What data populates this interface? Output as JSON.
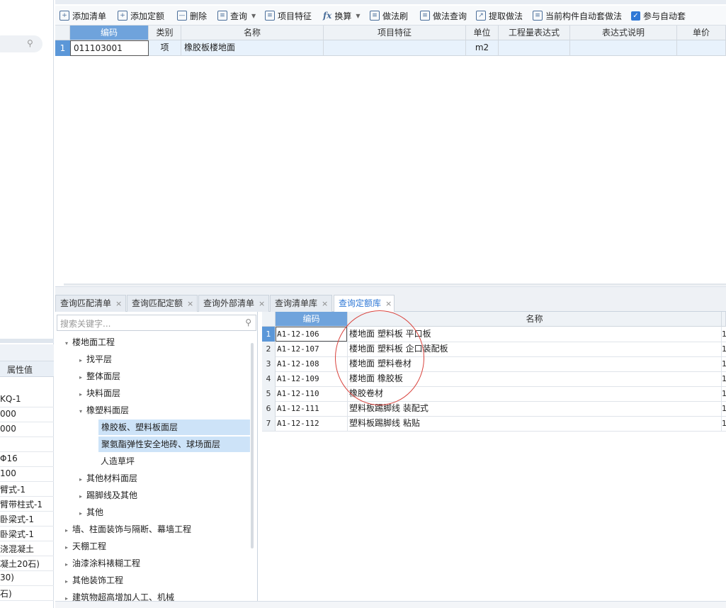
{
  "left_panel": {
    "prop_header": "属性值",
    "prop_values": [
      "KQ-1",
      "000",
      "000",
      "",
      "Φ16",
      "100",
      "臂式-1",
      "臂带柱式-1",
      "卧梁式-1",
      "卧梁式-1",
      "浇混凝土",
      "凝土20石)",
      "30)",
      "石)"
    ]
  },
  "toolbar": {
    "add_list": "添加清单",
    "add_quota": "添加定额",
    "delete": "删除",
    "query": "查询",
    "item_feature": "项目特征",
    "convert": "换算",
    "method_brush": "做法刷",
    "method_query": "做法查询",
    "extract_method": "提取做法",
    "auto_method": "当前构件自动套做法",
    "auto_participate": "参与自动套"
  },
  "top_grid": {
    "headers": [
      "编码",
      "类别",
      "名称",
      "项目特征",
      "单位",
      "工程量表达式",
      "表达式说明",
      "单价"
    ],
    "row": {
      "num": "1",
      "code": "011103001",
      "type": "项",
      "name": "橡胶板楼地面",
      "feature": "",
      "unit": "m2",
      "expr": "",
      "expr_note": "",
      "price": ""
    }
  },
  "bottom_tabs": [
    "查询匹配清单",
    "查询匹配定额",
    "查询外部清单",
    "查询清单库",
    "查询定额库"
  ],
  "tree": {
    "search_placeholder": "搜索关键字...",
    "nodes": [
      "楼地面工程",
      "找平层",
      "整体面层",
      "块料面层",
      "橡塑料面层",
      "橡胶板、塑料板面层",
      "聚氨酯弹性安全地砖、球场面层",
      "人造草坪",
      "其他材料面层",
      "踢脚线及其他",
      "其他",
      "墙、柱面装饰与隔断、幕墙工程",
      "天棚工程",
      "油漆涂料裱糊工程",
      "其他装饰工程",
      "建筑物超高增加人工、机械"
    ]
  },
  "result_grid": {
    "headers": [
      "编码",
      "名称"
    ],
    "rows": [
      {
        "num": "1",
        "code": "A1-12-106",
        "name": "楼地面 塑料板 平口板",
        "extra": "1"
      },
      {
        "num": "2",
        "code": "A1-12-107",
        "name": "楼地面 塑料板 企口装配板",
        "extra": "1"
      },
      {
        "num": "3",
        "code": "A1-12-108",
        "name": "楼地面 塑料卷材",
        "extra": "1"
      },
      {
        "num": "4",
        "code": "A1-12-109",
        "name": "楼地面 橡胶板",
        "extra": "1"
      },
      {
        "num": "5",
        "code": "A1-12-110",
        "name": "橡胶卷材",
        "extra": "1"
      },
      {
        "num": "6",
        "code": "A1-12-111",
        "name": "塑料板踢脚线 装配式",
        "extra": "1"
      },
      {
        "num": "7",
        "code": "A1-12-112",
        "name": "塑料板踢脚线 粘贴",
        "extra": "1"
      }
    ]
  },
  "colors": {
    "accent": "#2f78d6",
    "header_active": "#6fa3dc",
    "selection": "#cde3f8",
    "annotation": "#d9433d"
  }
}
